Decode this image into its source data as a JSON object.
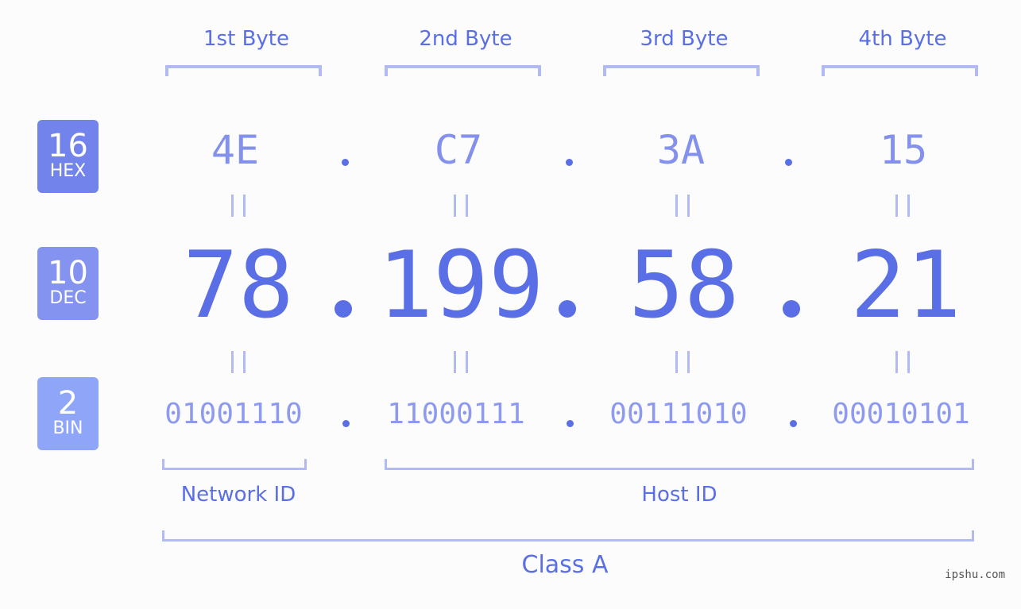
{
  "bytes": [
    {
      "label": "1st Byte",
      "hex": "4E",
      "dec": "78",
      "bin": "01001110"
    },
    {
      "label": "2nd Byte",
      "hex": "C7",
      "dec": "199",
      "bin": "11000111"
    },
    {
      "label": "3rd Byte",
      "hex": "3A",
      "dec": "58",
      "bin": "00111010"
    },
    {
      "label": "4th Byte",
      "hex": "15",
      "dec": "21",
      "bin": "00010101"
    }
  ],
  "badges": {
    "hex": {
      "num": "16",
      "label": "HEX",
      "color": "#7284eb"
    },
    "dec": {
      "num": "10",
      "label": "DEC",
      "color": "#8492f0"
    },
    "bin": {
      "num": "2",
      "label": "BIN",
      "color": "#8fa6f8"
    }
  },
  "separator": ".",
  "equals": "=",
  "network_id_label": "Network ID",
  "host_id_label": "Host ID",
  "class_label": "Class A",
  "watermark": "ipshu.com"
}
